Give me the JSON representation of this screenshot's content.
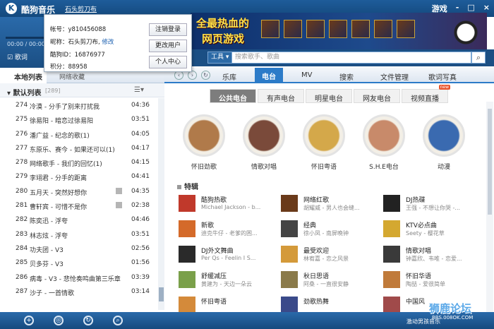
{
  "app": {
    "title": "酷狗音乐",
    "user": "石头剪刀布",
    "logo": "K",
    "controls": [
      "游戏",
      "-",
      "□",
      "×"
    ]
  },
  "player": {
    "time": "00:00 / 00:00",
    "lyrics_checkbox": "☑ 歌词"
  },
  "banner": {
    "line1": "全最热血的",
    "line2": "网页游戏"
  },
  "popup": {
    "account_label": "帐号：",
    "account": "y810456088",
    "nick_label": "昵称：",
    "nick": "石头剪刀布,",
    "nick_edit": "修改",
    "kugou_id_label": "酷狗ID：",
    "kugou_id": "16876977",
    "points_label": "积分：",
    "points": "88958",
    "logout": "注销登录",
    "switch_user": "更改用户",
    "personal_center": "个人中心"
  },
  "toolbar": {
    "tools": "工具 ▾",
    "search_placeholder": "搜索歌手、歌曲",
    "search_icon": "search-icon"
  },
  "left": {
    "tab_active": "本地列表",
    "tab_other": "网络收藏",
    "list_title": "默认列表",
    "list_count": "[289]",
    "menu": "☰▾"
  },
  "rows": [
    {
      "num": "274",
      "name": "冷漠 - 分手了别来打扰我",
      "dur": "04:36"
    },
    {
      "num": "275",
      "name": "徐易阳 - 暗恋过徐易阳",
      "dur": "03:51"
    },
    {
      "num": "276",
      "name": "潘广益 - 纪念的歌(1)",
      "dur": "04:05"
    },
    {
      "num": "277",
      "name": "东原乐、赛今 - 如果还可以(1)",
      "dur": "04:17"
    },
    {
      "num": "278",
      "name": "网络歌手 - 我们的回忆(1)",
      "dur": "04:15"
    },
    {
      "num": "279",
      "name": "李翊君 - 分手的距离",
      "dur": "04:41"
    },
    {
      "num": "280",
      "name": "五月天 - 突然好想你",
      "dur": "04:35",
      "icon": true
    },
    {
      "num": "281",
      "name": "曹轩宾 - 可惜不是你",
      "dur": "02:38",
      "icon": true
    },
    {
      "num": "282",
      "name": "陈奕迅 - 浮夸",
      "dur": "04:46"
    },
    {
      "num": "283",
      "name": "林志炫 - 浮夸",
      "dur": "03:51"
    },
    {
      "num": "284",
      "name": "功夫团 - V3",
      "dur": "02:56"
    },
    {
      "num": "285",
      "name": "贝多芬 - V3",
      "dur": "01:56"
    },
    {
      "num": "286",
      "name": "病毒 - V3 - 悲怆奏鸣曲第三乐章",
      "dur": "03:39"
    },
    {
      "num": "287",
      "name": "沙子 - 一首情歌",
      "dur": "03:14"
    }
  ],
  "main_tabs": [
    "乐库",
    "电台",
    "MV",
    "搜索",
    "文件管理",
    "歌词写真"
  ],
  "sub_tabs": [
    "公共电台",
    "有声电台",
    "明星电台",
    "网友电台",
    "视频直播"
  ],
  "sub_badge": "new",
  "stations": [
    {
      "label": "怀旧劲歌",
      "color": "#b07a4a"
    },
    {
      "label": "情歌对唱",
      "color": "#7a4a3a"
    },
    {
      "label": "怀旧粤语",
      "color": "#d4a84a"
    },
    {
      "label": "S.H.E电台",
      "color": "#c88a6a"
    },
    {
      "label": "动漫",
      "color": "#3a6ab0"
    }
  ],
  "section": "特辑",
  "features": [
    {
      "t1": "酷狗热歌",
      "t2": "Michael Jackson - b...",
      "c": "#c0392b"
    },
    {
      "t1": "网络红歌",
      "t2": "胡耀威 - 男人也会缝...",
      "c": "#6a3a1a"
    },
    {
      "t1": "DJ热碟",
      "t2": "王强 - 不想让你哭 -...",
      "c": "#222"
    },
    {
      "t1": "新歌",
      "t2": "迪克牛仔 - 老爹的困...",
      "c": "#d46a2a"
    },
    {
      "t1": "经典",
      "t2": "徐小凤 - 南屏晚钟",
      "c": "#444"
    },
    {
      "t1": "KTV必点曲",
      "t2": "Seety - 樱花草",
      "c": "#d4a830"
    },
    {
      "t1": "DJ外文舞曲",
      "t2": "Per Qs - Feelin I S...",
      "c": "#2a2a2a"
    },
    {
      "t1": "最受欢迎",
      "t2": "林宥嘉 - 恋之风景",
      "c": "#d49a3a"
    },
    {
      "t1": "情歌对唱",
      "t2": "钟嘉欣、韦唯 - 恋爱...",
      "c": "#3a3a3a"
    },
    {
      "t1": "舒缓减压",
      "t2": "黄建为 - 天边一朵云",
      "c": "#7aa04a"
    },
    {
      "t1": "秋日思语",
      "t2": "阿桑 - 一直很安静",
      "c": "#8a7a4a"
    },
    {
      "t1": "怀旧华语",
      "t2": "陶喆 - 爱很简单",
      "c": "#c07a3a"
    },
    {
      "t1": "怀旧粤语",
      "t2": "",
      "c": "#d48a3a"
    },
    {
      "t1": "劲歌热舞",
      "t2": "",
      "c": "#3a4a8a"
    },
    {
      "t1": "中国风",
      "t2": "",
      "c": "#a04a4a"
    }
  ],
  "bottom": {
    "text": "激动男孩音乐"
  },
  "watermark": {
    "big": "狮鹿论坛",
    "small": "BBS.008OK.COM"
  }
}
